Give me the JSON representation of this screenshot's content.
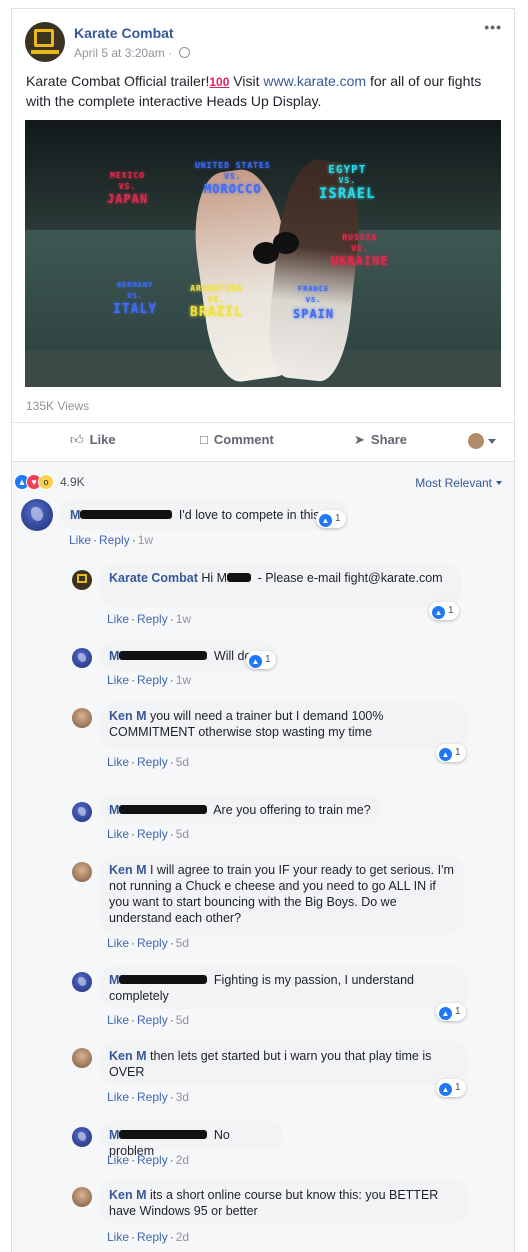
{
  "post": {
    "page_name": "Karate Combat",
    "timestamp": "April 5 at 3:20am",
    "text_before": "Karate Combat Official trailer!",
    "text_emoji": "100",
    "text_visit": " Visit ",
    "link": "www.karate.com",
    "text_after": " for all of our fights with the complete interactive Heads Up Display.",
    "video_overlay": {
      "l1": "MEXICO",
      "l1b": "VS.",
      "l1c": "JAPAN",
      "l2": "UNITED STATES",
      "l2b": "VS.",
      "l2c": "MOROCCO",
      "l3": "EGYPT",
      "l3b": "VS.",
      "l3c": "ISRAEL",
      "l4": "RUSSIA",
      "l4b": "VS.",
      "l4c": "UKRAINE",
      "l5": "GERMANY",
      "l5b": "VS.",
      "l5c": "ITALY",
      "l6": "ARGENTINA",
      "l6b": "VS.",
      "l6c": "BRAZIL",
      "l7": "FRANCE",
      "l7b": "VS.",
      "l7c": "SPAIN"
    },
    "views": "135K Views",
    "actions": {
      "like": "Like",
      "comment": "Comment",
      "share": "Share"
    }
  },
  "summary": {
    "reaction_count": "4.9K",
    "sort_label": "Most Relevant"
  },
  "comments": [
    {
      "name": "M",
      "text": "I'd love to compete in this",
      "like": "Like",
      "reply": "Reply",
      "time": "1w",
      "reactions": "1"
    },
    {
      "name": "Karate Combat",
      "text": "Hi M",
      "text2": " - Please e-mail fight@karate.com",
      "like": "Like",
      "reply": "Reply",
      "time": "1w",
      "reactions": "1"
    },
    {
      "name": "M",
      "text": "Will do",
      "like": "Like",
      "reply": "Reply",
      "time": "1w",
      "reactions": "1"
    },
    {
      "name": "Ken M",
      "text": "you will need a trainer but I demand 100% COMMITMENT otherwise stop wasting my time",
      "like": "Like",
      "reply": "Reply",
      "time": "5d",
      "reactions": "1"
    },
    {
      "name": "M",
      "text": "Are you offering to train me?",
      "like": "Like",
      "reply": "Reply",
      "time": "5d"
    },
    {
      "name": "Ken M",
      "text": "I will agree to train you IF your ready to get serious. I'm not running a Chuck e cheese and you need to go ALL IN if you want to start bouncing with the Big Boys. Do we understand each other?",
      "like": "Like",
      "reply": "Reply",
      "time": "5d"
    },
    {
      "name": "M",
      "text": "Fighting is my passion, I understand completely",
      "like": "Like",
      "reply": "Reply",
      "time": "5d",
      "reactions": "1"
    },
    {
      "name": "Ken M",
      "text": "then lets get started but i warn you that play time is OVER",
      "like": "Like",
      "reply": "Reply",
      "time": "3d",
      "reactions": "1"
    },
    {
      "name": "M",
      "text": "No problem",
      "like": "Like",
      "reply": "Reply",
      "time": "2d"
    },
    {
      "name": "Ken M",
      "text": "its a short online course but know this: you BETTER have Windows 95 or better",
      "like": "Like",
      "reply": "Reply",
      "time": "2d"
    }
  ],
  "icons": {
    "like": "thumbs-up-icon",
    "comment": "speech-bubble-icon",
    "share": "share-arrow-icon",
    "globe": "globe-icon",
    "more": "ellipsis-icon"
  },
  "colors": {
    "link": "#365899",
    "like_blue": "#2078f4",
    "love_red": "#f33e58",
    "wow_yellow": "#fcd04f"
  }
}
